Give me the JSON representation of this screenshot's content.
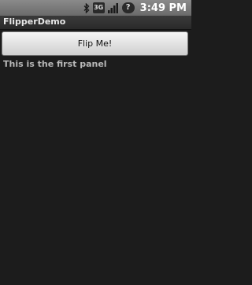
{
  "status_bar": {
    "time": "3:49 PM",
    "network_label": "3G",
    "battery_label": "?",
    "icons": [
      "bluetooth-icon",
      "network-3g-icon",
      "signal-icon",
      "battery-icon"
    ]
  },
  "app": {
    "title": "FlipperDemo"
  },
  "button": {
    "label": "Flip Me!"
  },
  "panel": {
    "text": "This is the first panel"
  }
}
